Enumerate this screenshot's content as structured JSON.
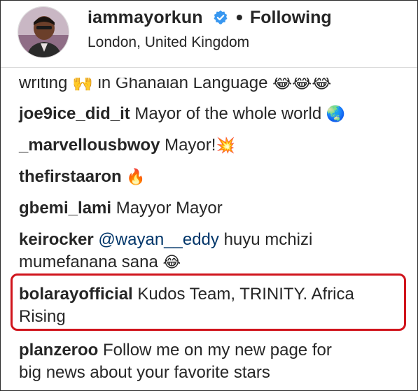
{
  "header": {
    "username": "iammayorkun",
    "separator": "•",
    "follow_label": "Following",
    "location": "London, United Kingdom"
  },
  "clipped_comment": {
    "text": "writing 🙌 in Ghanaian Language 😂😂😂"
  },
  "comments": [
    {
      "username": "joe9ice_did_it",
      "text": "Mayor of the whole world",
      "emoji": "🌏"
    },
    {
      "username": "_marvellousbwoy",
      "text": "Mayor!",
      "emoji": "💥"
    },
    {
      "username": "thefirstaaron",
      "text": "",
      "emoji": "🔥"
    },
    {
      "username": "gbemi_lami",
      "text": "Mayyor Mayor",
      "emoji": ""
    },
    {
      "username": "keirocker",
      "mention": "@wayan__eddy",
      "text": "huyu mchizi",
      "text2": "mumefanana sana",
      "emoji": "😂"
    },
    {
      "username": "bolarayofficial",
      "text": "Kudos Team, TRINITY. Africa",
      "text2": "Rising",
      "emoji": ""
    },
    {
      "username": "planzeroo",
      "text": "Follow me on my new page for",
      "text2": "big news about your favorite stars",
      "emoji": ""
    }
  ],
  "colors": {
    "highlight": "#d0141c",
    "verified": "#3897f0",
    "mention": "#003569"
  }
}
